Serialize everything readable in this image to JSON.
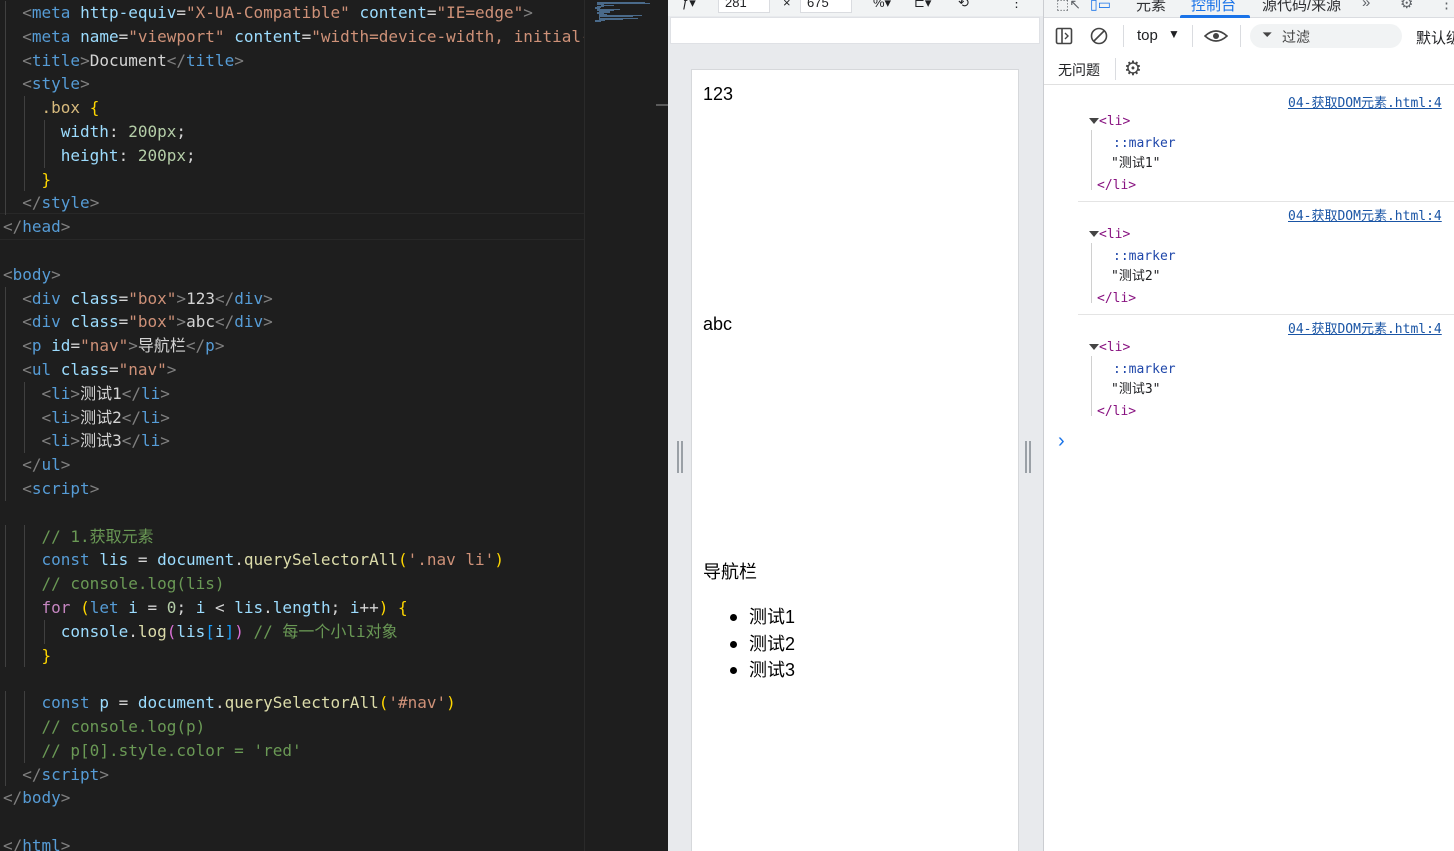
{
  "editor": {
    "lines": [
      {
        "indent": 1,
        "tokens": [
          [
            "br",
            "<"
          ],
          [
            "tag",
            "meta"
          ],
          [
            "txt",
            " "
          ],
          [
            "attr",
            "http-equiv"
          ],
          [
            "txt",
            "="
          ],
          [
            "str",
            "\"X-UA-Compatible\""
          ],
          [
            "txt",
            " "
          ],
          [
            "attr",
            "content"
          ],
          [
            "txt",
            "="
          ],
          [
            "str",
            "\"IE=edge\""
          ],
          [
            "br",
            ">"
          ]
        ]
      },
      {
        "indent": 1,
        "tokens": [
          [
            "br",
            "<"
          ],
          [
            "tag",
            "meta"
          ],
          [
            "txt",
            " "
          ],
          [
            "attr",
            "name"
          ],
          [
            "txt",
            "="
          ],
          [
            "str",
            "\"viewport\""
          ],
          [
            "txt",
            " "
          ],
          [
            "attr",
            "content"
          ],
          [
            "txt",
            "="
          ],
          [
            "str",
            "\"width=device-width, initial-"
          ]
        ]
      },
      {
        "indent": 1,
        "tokens": [
          [
            "br",
            "<"
          ],
          [
            "tag",
            "title"
          ],
          [
            "br",
            ">"
          ],
          [
            "txt",
            "Document"
          ],
          [
            "br",
            "</"
          ],
          [
            "tag",
            "title"
          ],
          [
            "br",
            ">"
          ]
        ]
      },
      {
        "indent": 1,
        "tokens": [
          [
            "br",
            "<"
          ],
          [
            "tag",
            "style"
          ],
          [
            "br",
            ">"
          ]
        ]
      },
      {
        "indent": 2,
        "tokens": [
          [
            "sel",
            ".box"
          ],
          [
            "txt",
            " "
          ],
          [
            "p1",
            "{"
          ]
        ]
      },
      {
        "indent": 3,
        "tokens": [
          [
            "prop",
            "width"
          ],
          [
            "txt",
            ": "
          ],
          [
            "num",
            "200px"
          ],
          [
            "txt",
            ";"
          ]
        ]
      },
      {
        "indent": 3,
        "tokens": [
          [
            "prop",
            "height"
          ],
          [
            "txt",
            ": "
          ],
          [
            "num",
            "200px"
          ],
          [
            "txt",
            ";"
          ]
        ]
      },
      {
        "indent": 2,
        "tokens": [
          [
            "p1",
            "}"
          ]
        ]
      },
      {
        "indent": 1,
        "tokens": [
          [
            "br",
            "</"
          ],
          [
            "tag",
            "style"
          ],
          [
            "br",
            ">"
          ]
        ]
      },
      {
        "indent": 0,
        "tokens": [
          [
            "br",
            "</"
          ],
          [
            "tag",
            "head"
          ],
          [
            "br",
            ">"
          ]
        ]
      },
      {
        "indent": 0,
        "tokens": []
      },
      {
        "indent": 0,
        "tokens": [
          [
            "br",
            "<"
          ],
          [
            "tag",
            "body"
          ],
          [
            "br",
            ">"
          ]
        ]
      },
      {
        "indent": 1,
        "tokens": [
          [
            "br",
            "<"
          ],
          [
            "tag",
            "div"
          ],
          [
            "txt",
            " "
          ],
          [
            "attr",
            "class"
          ],
          [
            "txt",
            "="
          ],
          [
            "str",
            "\"box\""
          ],
          [
            "br",
            ">"
          ],
          [
            "txt",
            "123"
          ],
          [
            "br",
            "</"
          ],
          [
            "tag",
            "div"
          ],
          [
            "br",
            ">"
          ]
        ]
      },
      {
        "indent": 1,
        "tokens": [
          [
            "br",
            "<"
          ],
          [
            "tag",
            "div"
          ],
          [
            "txt",
            " "
          ],
          [
            "attr",
            "class"
          ],
          [
            "txt",
            "="
          ],
          [
            "str",
            "\"box\""
          ],
          [
            "br",
            ">"
          ],
          [
            "txt",
            "abc"
          ],
          [
            "br",
            "</"
          ],
          [
            "tag",
            "div"
          ],
          [
            "br",
            ">"
          ]
        ]
      },
      {
        "indent": 1,
        "tokens": [
          [
            "br",
            "<"
          ],
          [
            "tag",
            "p"
          ],
          [
            "txt",
            " "
          ],
          [
            "attr",
            "id"
          ],
          [
            "txt",
            "="
          ],
          [
            "str",
            "\"nav\""
          ],
          [
            "br",
            ">"
          ],
          [
            "txt",
            "导航栏"
          ],
          [
            "br",
            "</"
          ],
          [
            "tag",
            "p"
          ],
          [
            "br",
            ">"
          ]
        ]
      },
      {
        "indent": 1,
        "tokens": [
          [
            "br",
            "<"
          ],
          [
            "tag",
            "ul"
          ],
          [
            "txt",
            " "
          ],
          [
            "attr",
            "class"
          ],
          [
            "txt",
            "="
          ],
          [
            "str",
            "\"nav\""
          ],
          [
            "br",
            ">"
          ]
        ]
      },
      {
        "indent": 2,
        "tokens": [
          [
            "br",
            "<"
          ],
          [
            "tag",
            "li"
          ],
          [
            "br",
            ">"
          ],
          [
            "txt",
            "测试1"
          ],
          [
            "br",
            "</"
          ],
          [
            "tag",
            "li"
          ],
          [
            "br",
            ">"
          ]
        ]
      },
      {
        "indent": 2,
        "tokens": [
          [
            "br",
            "<"
          ],
          [
            "tag",
            "li"
          ],
          [
            "br",
            ">"
          ],
          [
            "txt",
            "测试2"
          ],
          [
            "br",
            "</"
          ],
          [
            "tag",
            "li"
          ],
          [
            "br",
            ">"
          ]
        ]
      },
      {
        "indent": 2,
        "tokens": [
          [
            "br",
            "<"
          ],
          [
            "tag",
            "li"
          ],
          [
            "br",
            ">"
          ],
          [
            "txt",
            "测试3"
          ],
          [
            "br",
            "</"
          ],
          [
            "tag",
            "li"
          ],
          [
            "br",
            ">"
          ]
        ]
      },
      {
        "indent": 1,
        "tokens": [
          [
            "br",
            "</"
          ],
          [
            "tag",
            "ul"
          ],
          [
            "br",
            ">"
          ]
        ]
      },
      {
        "indent": 1,
        "tokens": [
          [
            "br",
            "<"
          ],
          [
            "tag",
            "script"
          ],
          [
            "br",
            ">"
          ]
        ]
      },
      {
        "indent": 0,
        "tokens": []
      },
      {
        "indent": 2,
        "tokens": [
          [
            "cmt",
            "// 1.获取元素"
          ]
        ]
      },
      {
        "indent": 2,
        "tokens": [
          [
            "kw",
            "const"
          ],
          [
            "txt",
            " "
          ],
          [
            "var",
            "lis"
          ],
          [
            "txt",
            " = "
          ],
          [
            "var",
            "document"
          ],
          [
            "txt",
            "."
          ],
          [
            "fn",
            "querySelectorAll"
          ],
          [
            "p1",
            "("
          ],
          [
            "str",
            "'.nav li'"
          ],
          [
            "p1",
            ")"
          ]
        ]
      },
      {
        "indent": 2,
        "tokens": [
          [
            "cmt",
            "// console.log(lis)"
          ]
        ]
      },
      {
        "indent": 2,
        "tokens": [
          [
            "ctl",
            "for"
          ],
          [
            "txt",
            " "
          ],
          [
            "p1",
            "("
          ],
          [
            "kw",
            "let"
          ],
          [
            "txt",
            " "
          ],
          [
            "var",
            "i"
          ],
          [
            "txt",
            " = "
          ],
          [
            "num",
            "0"
          ],
          [
            "txt",
            "; "
          ],
          [
            "var",
            "i"
          ],
          [
            "txt",
            " < "
          ],
          [
            "var",
            "lis"
          ],
          [
            "txt",
            "."
          ],
          [
            "var",
            "length"
          ],
          [
            "txt",
            "; "
          ],
          [
            "var",
            "i"
          ],
          [
            "txt",
            "++"
          ],
          [
            "p1",
            ")"
          ],
          [
            "txt",
            " "
          ],
          [
            "p1",
            "{"
          ]
        ]
      },
      {
        "indent": 3,
        "tokens": [
          [
            "var",
            "console"
          ],
          [
            "txt",
            "."
          ],
          [
            "fn",
            "log"
          ],
          [
            "p2",
            "("
          ],
          [
            "var",
            "lis"
          ],
          [
            "p3",
            "["
          ],
          [
            "var",
            "i"
          ],
          [
            "p3",
            "]"
          ],
          [
            "p2",
            ")"
          ],
          [
            "txt",
            " "
          ],
          [
            "cmt",
            "// 每一个小li对象"
          ]
        ]
      },
      {
        "indent": 2,
        "tokens": [
          [
            "p1",
            "}"
          ]
        ]
      },
      {
        "indent": 0,
        "tokens": []
      },
      {
        "indent": 2,
        "tokens": [
          [
            "kw",
            "const"
          ],
          [
            "txt",
            " "
          ],
          [
            "var",
            "p"
          ],
          [
            "txt",
            " = "
          ],
          [
            "var",
            "document"
          ],
          [
            "txt",
            "."
          ],
          [
            "fn",
            "querySelectorAll"
          ],
          [
            "p1",
            "("
          ],
          [
            "str",
            "'#nav'"
          ],
          [
            "p1",
            ")"
          ]
        ]
      },
      {
        "indent": 2,
        "tokens": [
          [
            "cmt",
            "// console.log(p)"
          ]
        ]
      },
      {
        "indent": 2,
        "tokens": [
          [
            "cmt",
            "// p[0].style.color = 'red'"
          ]
        ]
      },
      {
        "indent": 1,
        "tokens": [
          [
            "br",
            "</"
          ],
          [
            "tag",
            "script"
          ],
          [
            "br",
            ">"
          ]
        ]
      },
      {
        "indent": 0,
        "tokens": [
          [
            "br",
            "</"
          ],
          [
            "tag",
            "body"
          ],
          [
            "br",
            ">"
          ]
        ]
      },
      {
        "indent": 0,
        "tokens": []
      },
      {
        "indent": 0,
        "tokens": [
          [
            "br",
            "</"
          ],
          [
            "tag",
            "html"
          ],
          [
            "br",
            ">"
          ]
        ]
      }
    ]
  },
  "device_toolbar": {
    "width_value": "281",
    "height_value": "675",
    "times": "×"
  },
  "page": {
    "box1_text": "123",
    "box2_text": "abc",
    "nav_text": "导航栏",
    "list_items": [
      "测试1",
      "测试2",
      "测试3"
    ]
  },
  "devtools": {
    "tabs": [
      "元素",
      "控制台",
      "源代码/来源"
    ],
    "active_tab": "控制台",
    "context": "top",
    "filter_placeholder": "过滤",
    "levels_label": "默认级",
    "issues_label": "无问题",
    "logs": [
      {
        "source": "04-获取DOM元素.html:4",
        "open_tag": "<li>",
        "pseudo": "::marker",
        "text": "\"测试1\"",
        "close_tag": "</li>"
      },
      {
        "source": "04-获取DOM元素.html:4",
        "open_tag": "<li>",
        "pseudo": "::marker",
        "text": "\"测试2\"",
        "close_tag": "</li>"
      },
      {
        "source": "04-获取DOM元素.html:4",
        "open_tag": "<li>",
        "pseudo": "::marker",
        "text": "\"测试3\"",
        "close_tag": "</li>"
      }
    ],
    "prompt": "›"
  },
  "colors": {
    "accent": "#1a73e8",
    "editor_bg": "#1e1e1e",
    "link": "#1a55a5",
    "tag_purple": "#881280"
  }
}
